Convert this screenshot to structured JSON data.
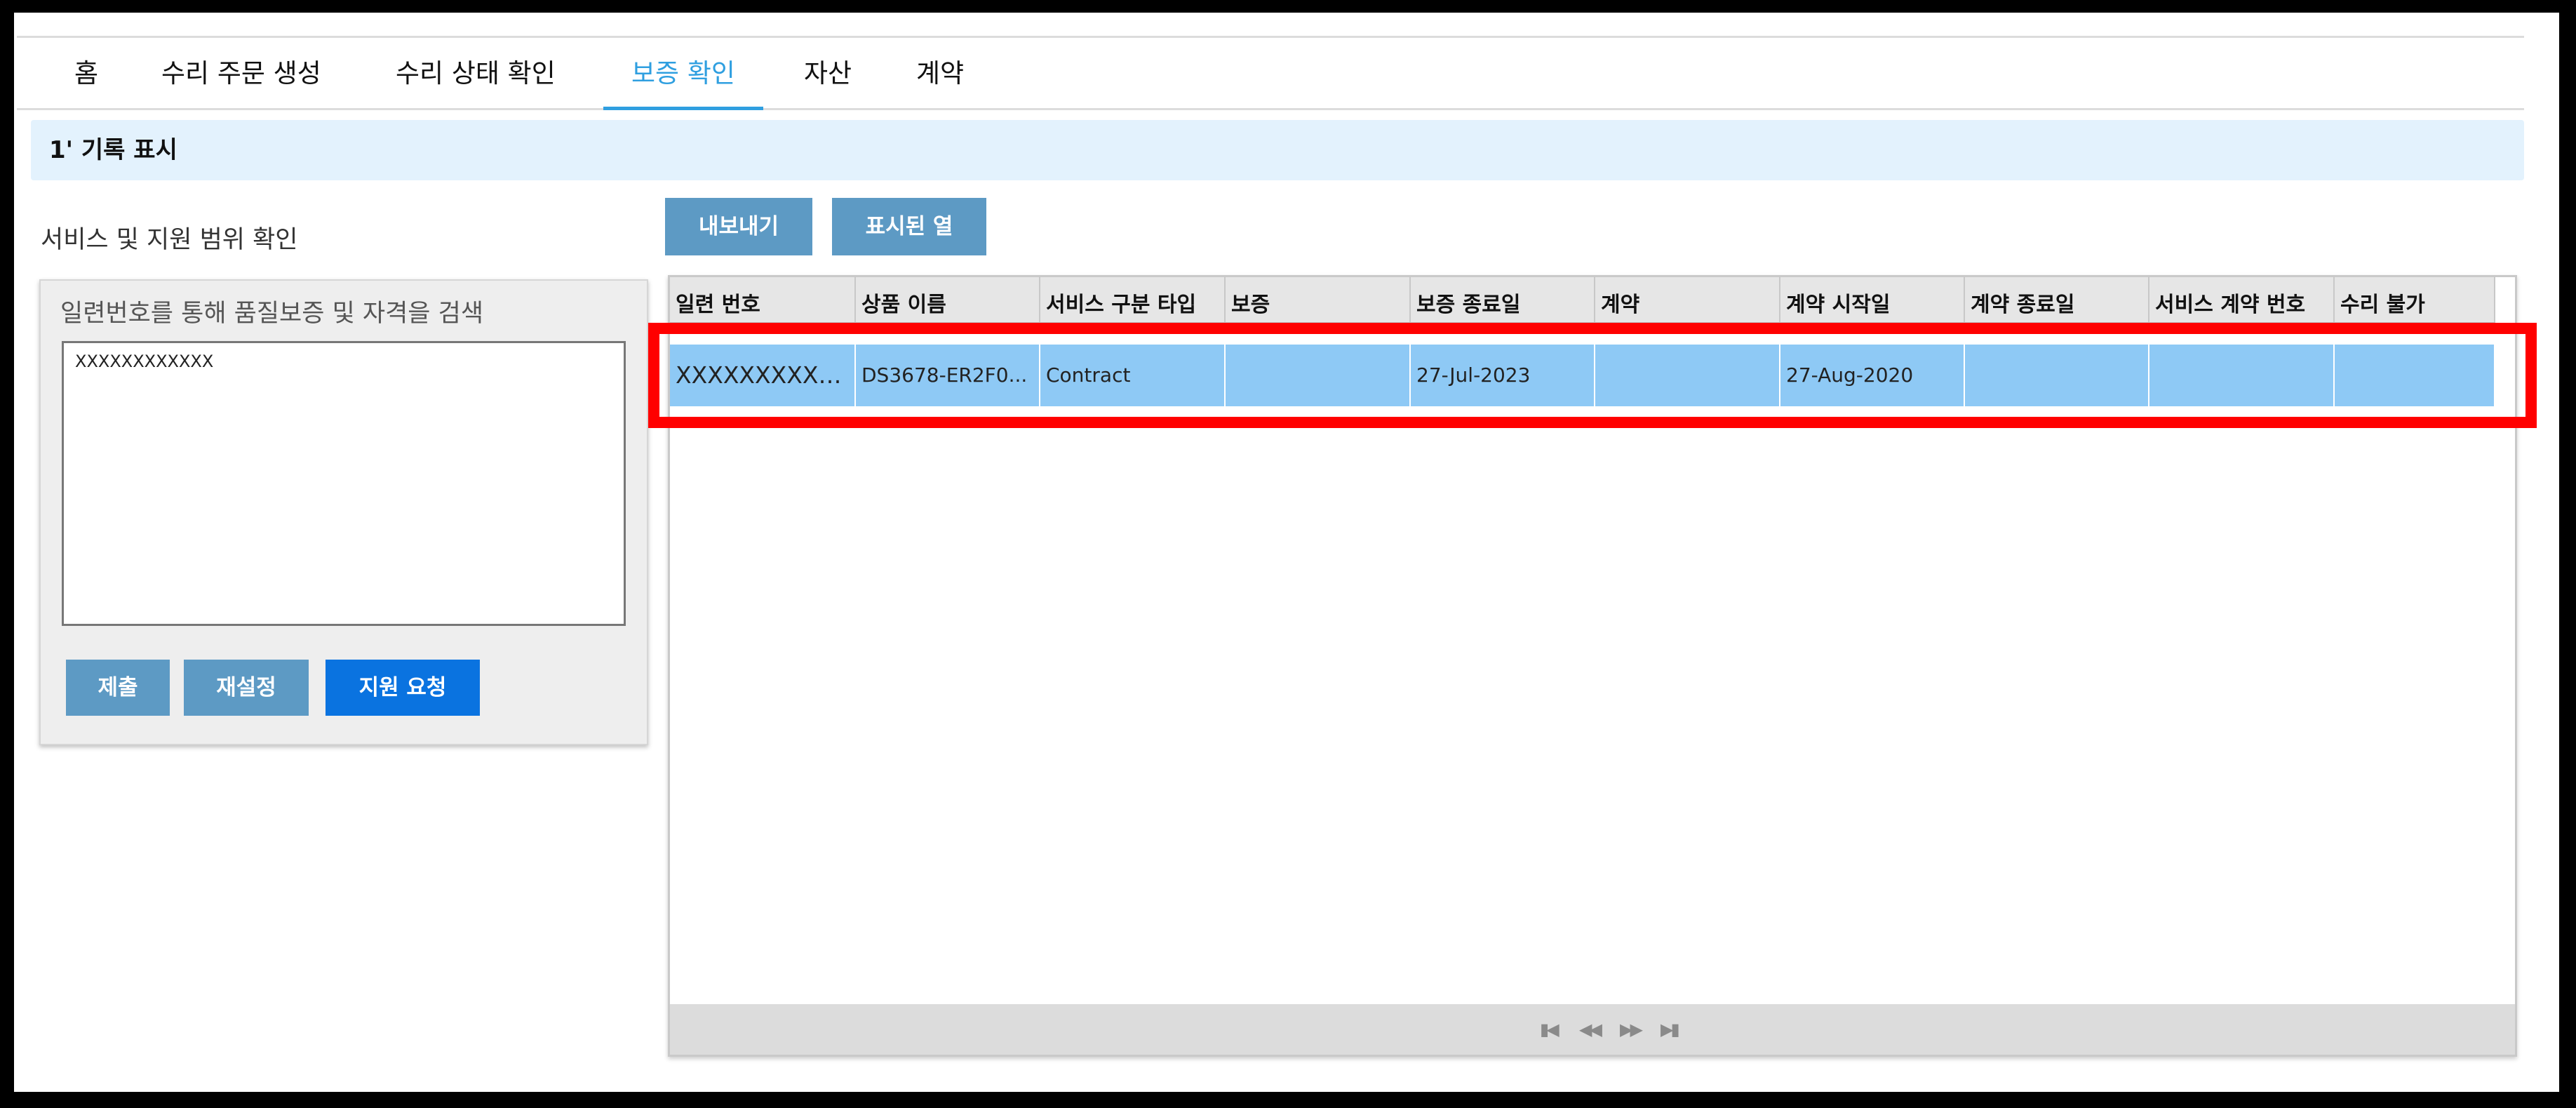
{
  "nav": {
    "tabs": [
      {
        "label": "홈"
      },
      {
        "label": "수리 주문 생성"
      },
      {
        "label": "수리 상태 확인"
      },
      {
        "label": "보증 확인"
      },
      {
        "label": "자산"
      },
      {
        "label": "계약"
      }
    ],
    "active_tab": "보증 확인"
  },
  "banner": {
    "text": "1' 기록 표시"
  },
  "left_panel": {
    "title": "서비스 및 지원 범위 확인",
    "search_label": "일련번호를 통해 품질보증 및 자격을 검색",
    "serial_value": "XXXXXXXXXXXX",
    "buttons": {
      "submit": "제출",
      "reset": "재설정",
      "support": "지원 요청"
    }
  },
  "toolbar": {
    "export": "내보내기",
    "columns": "표시된 열"
  },
  "grid": {
    "columns": [
      "일련 번호",
      "상품 이름",
      "서비스 구분 타입",
      "보증",
      "보증 종료일",
      "계약",
      "계약 시작일",
      "계약 종료일",
      "서비스 계약 번호",
      "수리 불가"
    ],
    "rows": [
      [
        "XXXXXXXXXXXX",
        "DS3678-ER2F0...",
        "Contract",
        "",
        "27-Jul-2023",
        "",
        "27-Aug-2020",
        "",
        "",
        ""
      ]
    ],
    "pager": {
      "first": "first-page-icon",
      "prev": "prev-page-icon",
      "next": "next-page-icon",
      "last": "last-page-icon"
    }
  },
  "colors": {
    "accent": "#2f9fe0",
    "banner_bg": "#e3f2fd",
    "row_selected": "#8ec9f5",
    "highlight": "#ff0000"
  }
}
